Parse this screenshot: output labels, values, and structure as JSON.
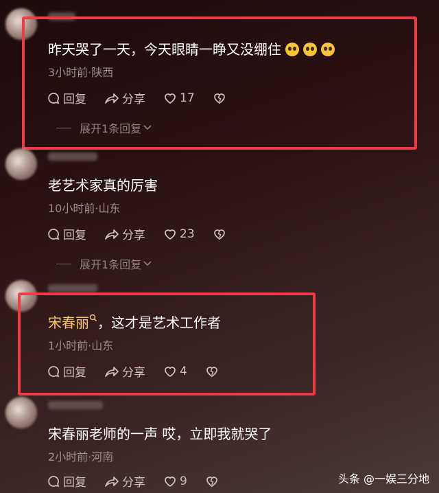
{
  "comments": [
    {
      "text": "昨天哭了一天，今天眼睛一睁又没绷住",
      "emoji_count": 3,
      "meta": "3小时前·陕西",
      "reply_label": "回复",
      "share_label": "分享",
      "likes": "17",
      "expand_label": "展开1条回复"
    },
    {
      "text": "老艺术家真的厉害",
      "meta": "10小时前·山东",
      "reply_label": "回复",
      "share_label": "分享",
      "likes": "23",
      "expand_label": "展开1条回复"
    },
    {
      "mention": "宋春丽",
      "text": "，这才是艺术工作者",
      "meta": "1小时前·山东",
      "reply_label": "回复",
      "share_label": "分享",
      "likes": "4"
    },
    {
      "text": "宋春丽老师的一声 哎，立即我就哭了",
      "meta": "2小时前·河南",
      "reply_label": "回复",
      "share_label": "分享",
      "likes": "9"
    }
  ],
  "watermark": "头条 @一娱三分地",
  "colors": {
    "highlight": "#ee3b47",
    "mention": "#f2c86a",
    "meta": "#9c8f8d"
  }
}
